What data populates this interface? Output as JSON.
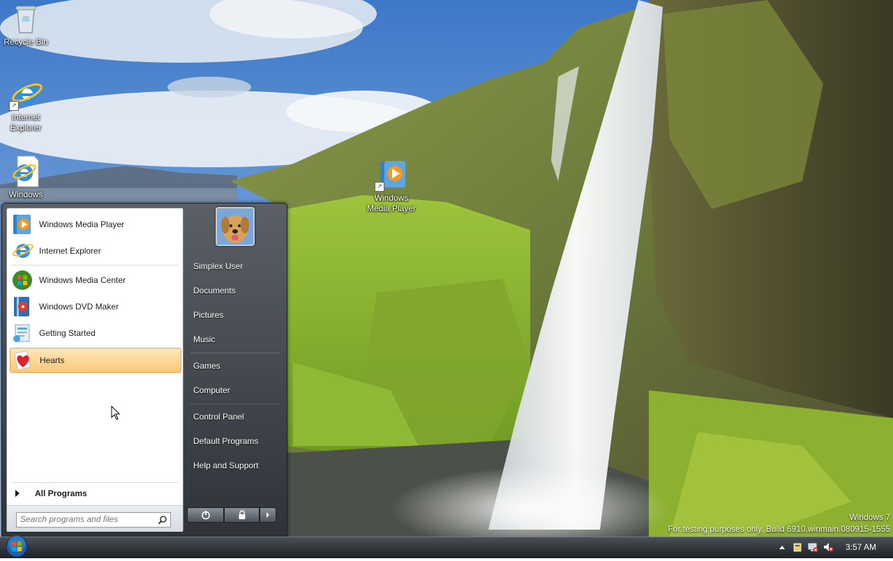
{
  "desktop": {
    "icons": [
      {
        "label": "Recycle Bin"
      },
      {
        "label": "Internet Explorer"
      },
      {
        "label": "Windows"
      },
      {
        "label": "Windows Media Player"
      }
    ]
  },
  "start_menu": {
    "programs": [
      {
        "label": "Windows Media Player",
        "icon": "media-player-icon"
      },
      {
        "label": "Internet Explorer",
        "icon": "internet-explorer-icon"
      },
      {
        "label": "Windows Media Center",
        "icon": "media-center-icon"
      },
      {
        "label": "Windows DVD Maker",
        "icon": "dvd-maker-icon"
      },
      {
        "label": "Getting Started",
        "icon": "getting-started-icon"
      },
      {
        "label": "Hearts",
        "icon": "hearts-icon"
      }
    ],
    "all_programs": "All Programs",
    "search_placeholder": "Search programs and files",
    "right": {
      "user": "Simplex User",
      "documents": "Documents",
      "pictures": "Pictures",
      "music": "Music",
      "games": "Games",
      "computer": "Computer",
      "control_panel": "Control Panel",
      "default_programs": "Default Programs",
      "help": "Help and Support"
    }
  },
  "watermark": {
    "line1": "Windows 7",
    "line2": "For testing purposes only. Build 6910.winmain.080915-1555"
  },
  "taskbar": {
    "clock": "3:57 AM"
  },
  "colors": {
    "highlight": "#fbc87a",
    "menu_dark": "#2e3338",
    "sky": "#4a86d0"
  }
}
